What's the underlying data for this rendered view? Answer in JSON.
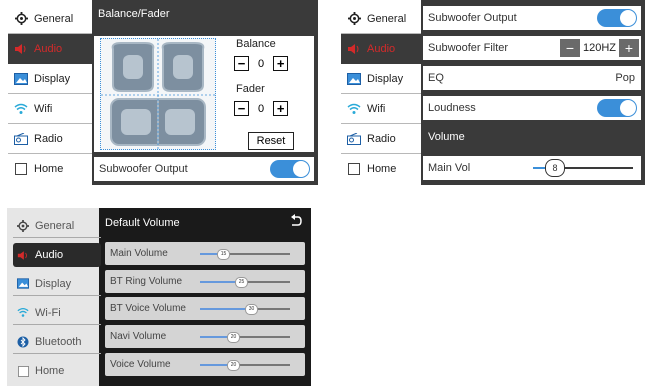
{
  "left_panel": {
    "sidebar": [
      {
        "label": "General",
        "icon": "gear-icon"
      },
      {
        "label": "Audio",
        "icon": "speaker-icon"
      },
      {
        "label": "Display",
        "icon": "image-icon"
      },
      {
        "label": "Wifi",
        "icon": "wifi-icon"
      },
      {
        "label": "Radio",
        "icon": "radio-icon"
      },
      {
        "label": "Home",
        "icon": "checkbox-icon"
      }
    ],
    "title": "Balance/Fader",
    "balance_label": "Balance",
    "balance_value": "0",
    "fader_label": "Fader",
    "fader_value": "0",
    "reset_label": "Reset",
    "subwoofer_output_label": "Subwoofer Output",
    "subwoofer_output_on": true
  },
  "right_panel": {
    "sidebar": [
      {
        "label": "General",
        "icon": "gear-icon"
      },
      {
        "label": "Audio",
        "icon": "speaker-icon"
      },
      {
        "label": "Display",
        "icon": "image-icon"
      },
      {
        "label": "Wifi",
        "icon": "wifi-icon"
      },
      {
        "label": "Radio",
        "icon": "radio-icon"
      },
      {
        "label": "Home",
        "icon": "checkbox-icon"
      }
    ],
    "subwoofer_output_label": "Subwoofer Output",
    "subwoofer_filter_label": "Subwoofer Filter",
    "subwoofer_filter_value": "120HZ",
    "eq_label": "EQ",
    "eq_value": "Pop",
    "loudness_label": "Loudness",
    "volume_header": "Volume",
    "main_vol_label": "Main Vol",
    "main_vol_value": "8"
  },
  "bottom_panel": {
    "sidebar": [
      {
        "label": "General",
        "icon": "gear-icon"
      },
      {
        "label": "Audio",
        "icon": "speaker-icon"
      },
      {
        "label": "Display",
        "icon": "image-icon"
      },
      {
        "label": "Wi-Fi",
        "icon": "wifi-icon"
      },
      {
        "label": "Bluetooth",
        "icon": "bluetooth-icon"
      },
      {
        "label": "Home",
        "icon": "checkbox-icon"
      }
    ],
    "title": "Default Volume",
    "back_icon": "back-arrow-icon",
    "rows": [
      {
        "label": "Main Volume",
        "value": "15"
      },
      {
        "label": "BT Ring Volume",
        "value": "25"
      },
      {
        "label": "BT Voice Volume",
        "value": "30"
      },
      {
        "label": "Navi Volume",
        "value": "20"
      },
      {
        "label": "Voice Volume",
        "value": "20"
      }
    ]
  },
  "colors": {
    "accent": "#3b8fd9",
    "dark": "#3a3a3a",
    "audio_icon": "#d42a2a"
  }
}
